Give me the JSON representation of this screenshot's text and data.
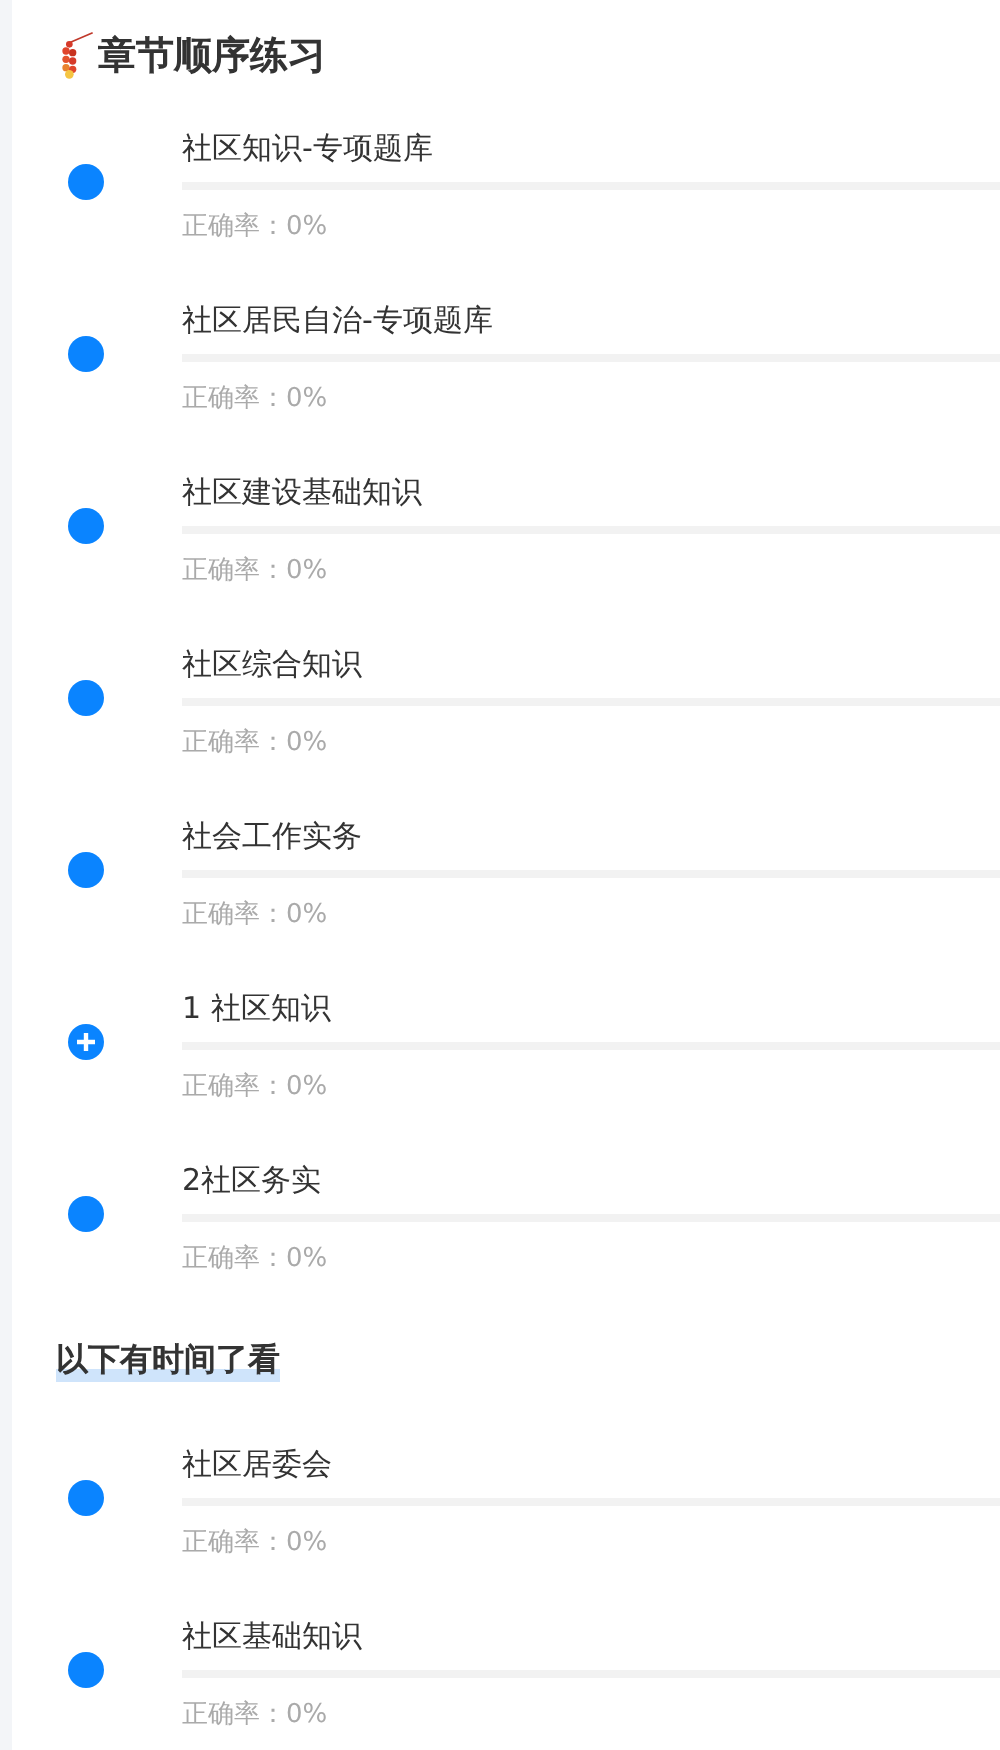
{
  "sections": [
    {
      "kind": "icon-heading",
      "title": "章节顺序练习",
      "items": [
        {
          "kind": "dot",
          "name": "社区知识-专项题库",
          "accuracy": "正确率：0%",
          "level": 0
        },
        {
          "kind": "dot",
          "name": "社区居民自治-专项题库",
          "accuracy": "正确率：0%",
          "level": 0
        },
        {
          "kind": "dot",
          "name": "社区建设基础知识",
          "accuracy": "正确率：0%",
          "level": 0
        },
        {
          "kind": "dot",
          "name": "社区综合知识",
          "accuracy": "正确率：0%",
          "level": 0
        },
        {
          "kind": "dot",
          "name": "社会工作实务",
          "accuracy": "正确率：0%",
          "level": 0
        },
        {
          "kind": "plus",
          "name": "1 社区知识",
          "accuracy": "正确率：0%",
          "level": 0
        },
        {
          "kind": "dot",
          "name": "2社区务实",
          "accuracy": "正确率：0%",
          "level": 0
        }
      ]
    },
    {
      "kind": "underlined",
      "title": "以下有时间了看",
      "items": [
        {
          "kind": "dot",
          "name": "社区居委会",
          "accuracy": "正确率：0%",
          "level": 0
        },
        {
          "kind": "dot",
          "name": "社区基础知识",
          "accuracy": "正确率：0%",
          "level": 0
        }
      ]
    }
  ]
}
